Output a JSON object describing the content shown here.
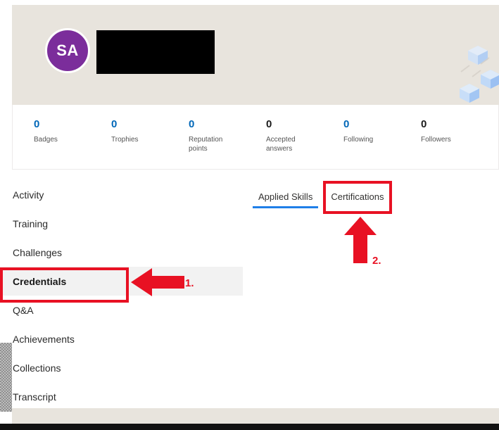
{
  "profile": {
    "avatar_initials": "SA",
    "avatar_color": "#7b2d9b",
    "name_redacted": true,
    "banner_color": "#e8e4dd",
    "decoration_icon": "cubes-graphic"
  },
  "stats": [
    {
      "value": "0",
      "label": "Badges",
      "accent": "#0067b8"
    },
    {
      "value": "0",
      "label": "Trophies",
      "accent": "#0067b8"
    },
    {
      "value": "0",
      "label": "Reputation points",
      "accent": "#0067b8"
    },
    {
      "value": "0",
      "label": "Accepted answers",
      "accent": "#1b1b1b"
    },
    {
      "value": "0",
      "label": "Following",
      "accent": "#0067b8"
    },
    {
      "value": "0",
      "label": "Followers",
      "accent": "#1b1b1b"
    }
  ],
  "sidebar": {
    "items": [
      {
        "label": "Activity",
        "selected": false
      },
      {
        "label": "Training",
        "selected": false
      },
      {
        "label": "Challenges",
        "selected": false
      },
      {
        "label": "Credentials",
        "selected": true
      },
      {
        "label": "Q&A",
        "selected": false
      },
      {
        "label": "Achievements",
        "selected": false
      },
      {
        "label": "Collections",
        "selected": false
      },
      {
        "label": "Transcript",
        "selected": false
      }
    ]
  },
  "tabs": [
    {
      "label": "Applied Skills",
      "active": true
    },
    {
      "label": "Certifications",
      "active": false
    }
  ],
  "annotations": {
    "color": "#e81123",
    "step_one": {
      "number": "1.",
      "target": "Credentials",
      "arrow": "arrow-left-icon"
    },
    "step_two": {
      "number": "2.",
      "target": "Certifications",
      "arrow": "arrow-up-icon"
    }
  }
}
